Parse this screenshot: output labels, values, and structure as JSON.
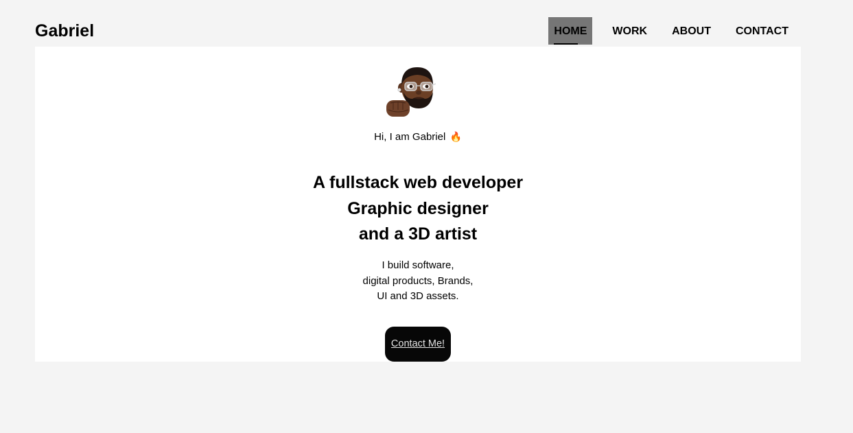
{
  "header": {
    "brand": "Gabriel",
    "nav": [
      {
        "label": "HOME",
        "active": true
      },
      {
        "label": "WORK",
        "active": false
      },
      {
        "label": "ABOUT",
        "active": false
      },
      {
        "label": "CONTACT",
        "active": false
      }
    ]
  },
  "hero": {
    "avatar_icon": "memoji-avatar-fist-icon",
    "greeting": "Hi, I am Gabriel",
    "greeting_emoji": "🔥",
    "headline_lines": [
      "A fullstack web developer",
      "Graphic designer",
      "and a 3D artist"
    ],
    "tagline_lines": [
      "I build software,",
      "digital products, Brands,",
      "UI and 3D assets."
    ],
    "cta_label": "Contact Me!"
  },
  "colors": {
    "page_bg": "#f4f4f4",
    "card_bg": "#ffffff",
    "active_nav_bg": "#767676",
    "cta_bg": "#070707",
    "cta_text": "#e4e4e4"
  }
}
